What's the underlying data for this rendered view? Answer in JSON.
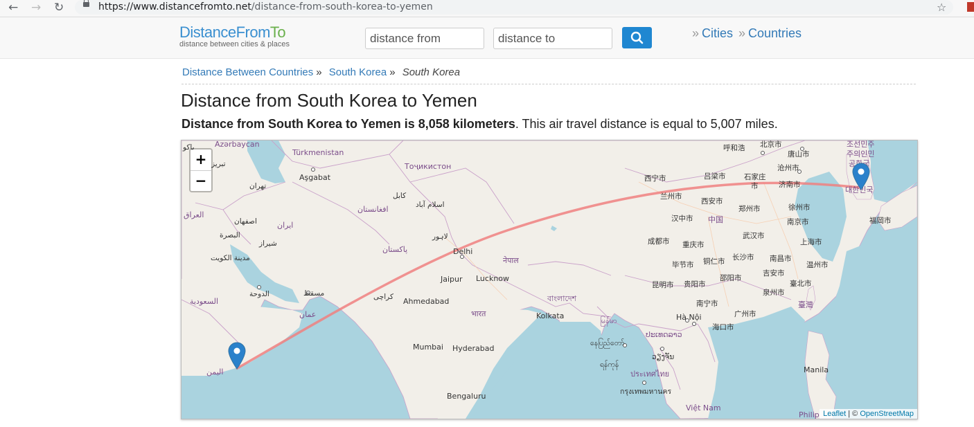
{
  "browser": {
    "url_domain": "https://www.distancefromto.net",
    "url_path": "/distance-from-south-korea-to-yemen"
  },
  "header": {
    "logo_main_part1": "DistanceFrom",
    "logo_main_part2": "To",
    "logo_tagline": "distance between cities & places",
    "from_placeholder": "distance from",
    "to_placeholder": "distance to",
    "link_cities": "Cities",
    "link_countries": "Countries",
    "raquo": "»"
  },
  "breadcrumb": {
    "items": [
      "Distance Between Countries",
      "South Korea"
    ],
    "current": "South Korea",
    "separator": "»"
  },
  "page": {
    "title": "Distance from South Korea to Yemen",
    "summary_bold": "Distance from South Korea to Yemen is 8,058 kilometers",
    "summary_rest": ". This air travel distance is equal to 5,007 miles."
  },
  "map": {
    "zoom_in": "+",
    "zoom_out": "−",
    "attribution_leaflet": "Leaflet",
    "attribution_sep": " | © ",
    "attribution_osm": "OpenStreetMap",
    "route_color": "#f08080",
    "marker_color": "#2a81cb",
    "labels": {
      "azerbaycan": "Azərbaycan",
      "turkmenistan": "Türkmenistan",
      "tojikiston": "Тоҷикистон",
      "ashgabat": "Aşgabat",
      "tabriz": "تبریز",
      "baku": "باكو",
      "tehran": "تهران",
      "kabul": "کابل",
      "islamabad": "اسلام آباد",
      "afghanistan": "افغانستان",
      "iraq": "العراق",
      "isfahan": "اصفهان",
      "iran": "ایران",
      "lahore": "لاہور",
      "basra": "البصرة",
      "shiraz": "شیراز",
      "pakistan": "پاکستان",
      "delhi": "Delhi",
      "kuwait": "مدينة الكويت",
      "nepal": "नेपाल",
      "doha": "الدوحة",
      "jaipur": "Jaipur",
      "lucknow": "Lucknow",
      "muscat": "مسقط",
      "karachi": "کراچی",
      "ahmedabad": "Ahmedabad",
      "saudi": "السعودية",
      "oman": "عمان",
      "bangladesh": "বাংলাদেশ",
      "bharat": "भारत",
      "kolkata": "Kolkata",
      "yemen": "اليمن",
      "mumbai": "Mumbai",
      "hyderabad": "Hyderabad",
      "bengaluru": "Bengaluru",
      "myanmar": "မြန်မာ",
      "naypyidaw": "နေပြည်တော်",
      "yangon": "ရန်ကုန်",
      "thailand": "ประเทศไทย",
      "bangkok": "กรุงเทพมหานคร",
      "laos": "ປະເທດລາວ",
      "vientiane": "ວຽງຈັນ",
      "hanoi": "Hà Nội",
      "vietnam": "Việt Nam",
      "manila": "Manila",
      "philippines": "Philip",
      "hohhot": "呼和浩",
      "beijing": "北京市",
      "tangshan": "唐山市",
      "north_korea_1": "조선민주",
      "north_korea_2": "주의인민",
      "north_korea_3": "공화국",
      "cangzhou": "沧州市",
      "xining": "西宁市",
      "lvliang": "吕梁市",
      "shijiazhuang_1": "石家庄",
      "shijiazhuang_2": "市",
      "jinan": "济南市",
      "south_korea": "대한민국",
      "lanzhou": "兰州市",
      "xian": "西安市",
      "zhengzhou": "郑州市",
      "xuzhou": "徐州市",
      "fukuoka": "福岡市",
      "hanzhong": "汉中市",
      "china": "中国",
      "nanjing": "南京市",
      "wuhan": "武汉市",
      "chengdu": "成都市",
      "chongqing": "重庆市",
      "shanghai": "上海市",
      "changsha": "长沙市",
      "tongren": "铜仁市",
      "nanchang": "南昌市",
      "bijie": "毕节市",
      "wenzhou": "温州市",
      "shaoyang": "邵阳市",
      "jian": "吉安市",
      "kunming": "昆明市",
      "guiyang": "贵阳市",
      "quanzhou": "泉州市",
      "taipei": "臺北市",
      "nanning": "南宁市",
      "taiwan": "臺灣",
      "guangzhou": "广州市",
      "haikou": "海口市"
    }
  }
}
